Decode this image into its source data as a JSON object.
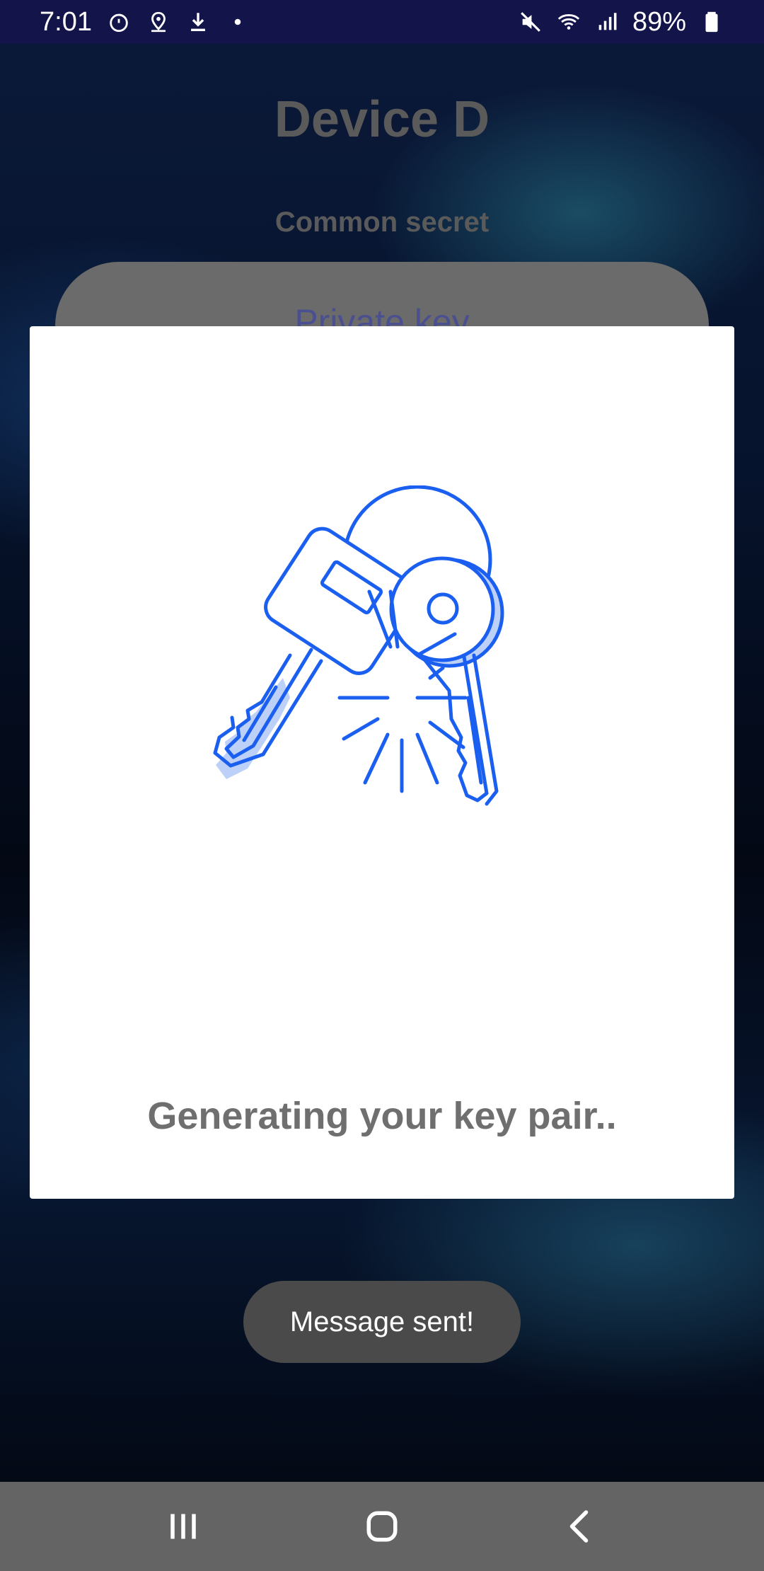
{
  "status_bar": {
    "time": "7:01",
    "battery_percent": "89%",
    "icons_left": [
      "timer-icon",
      "location-icon",
      "download-icon",
      "notification-dot-icon"
    ],
    "icons_right": [
      "mute-icon",
      "wifi-icon",
      "signal-icon",
      "battery-icon"
    ]
  },
  "app": {
    "title": "Device D",
    "subtitle": "Common secret",
    "card_label": "Private key"
  },
  "dialog": {
    "illustration": "keys-icon",
    "message": "Generating your key pair.."
  },
  "toast": {
    "text": "Message sent!"
  },
  "nav_bar": {
    "buttons": [
      "recents-icon",
      "home-icon",
      "back-icon"
    ]
  },
  "colors": {
    "accent_blue": "#1a5ff0",
    "dialog_bg": "#ffffff",
    "status_bar_bg": "#13144a"
  }
}
